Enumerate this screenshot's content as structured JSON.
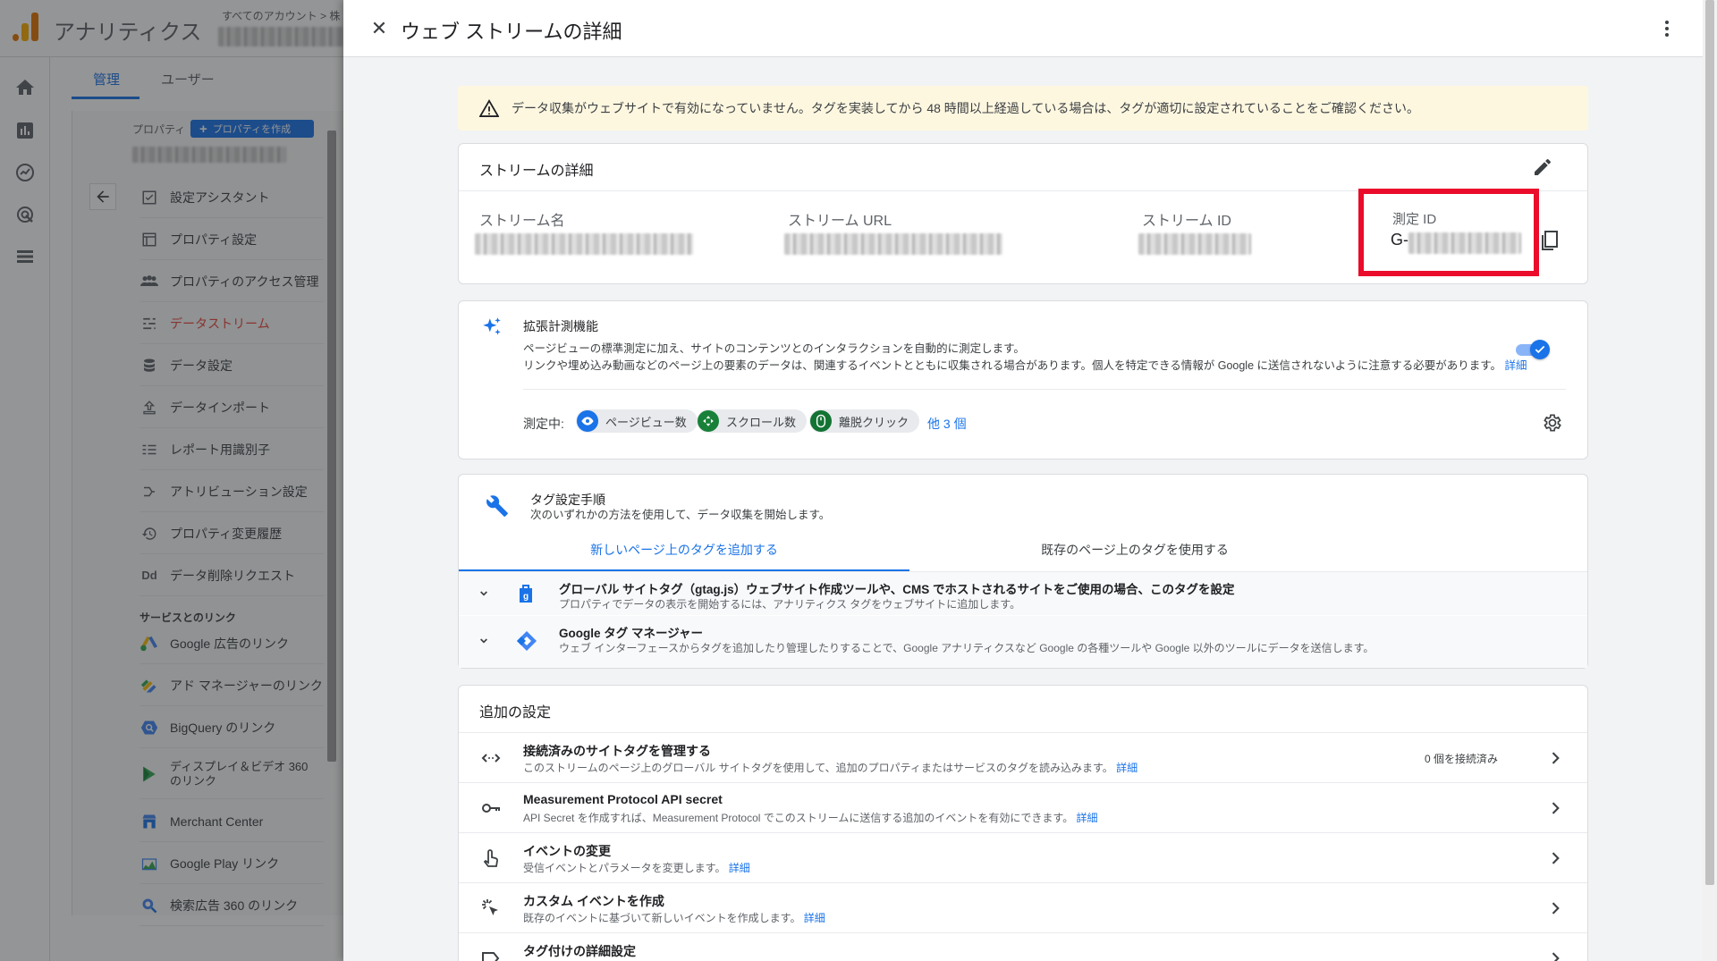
{
  "app": {
    "title": "アナリティクス",
    "account_crumb": "すべてのアカウント > 株",
    "colors": {
      "brand_orange": "#f9ab00",
      "brand_dark_orange": "#e37400",
      "accent": "#1a73e8",
      "active_nav": "#e8453c",
      "highlight_box": "#ea0c2a"
    }
  },
  "admin": {
    "tabs": [
      {
        "label": "管理",
        "active": true
      },
      {
        "label": "ユーザー",
        "active": false
      }
    ],
    "property_label": "プロパティ",
    "create_property_label": "プロパティを作成",
    "nav": [
      {
        "label": "設定アシスタント",
        "icon": "checkbox-icon"
      },
      {
        "label": "プロパティ設定",
        "icon": "property-icon"
      },
      {
        "label": "プロパティのアクセス管理",
        "icon": "people-icon"
      },
      {
        "label": "データストリーム",
        "icon": "streams-icon",
        "active": true
      },
      {
        "label": "データ設定",
        "icon": "database-icon"
      },
      {
        "label": "データインポート",
        "icon": "upload-icon"
      },
      {
        "label": "レポート用識別子",
        "icon": "identity-icon"
      },
      {
        "label": "アトリビューション設定",
        "icon": "attribution-icon"
      },
      {
        "label": "プロパティ変更履歴",
        "icon": "history-icon"
      },
      {
        "label": "データ削除リクエスト",
        "icon": "delete-request-icon",
        "glyph": "Dd"
      }
    ],
    "links_heading": "サービスとのリンク",
    "links": [
      {
        "label": "Google 広告のリンク",
        "icon": "google-ads-icon"
      },
      {
        "label": "アド マネージャーのリンク",
        "icon": "ad-manager-icon"
      },
      {
        "label": "BigQuery のリンク",
        "icon": "bigquery-icon"
      },
      {
        "label": "ディスプレイ＆ビデオ 360 のリンク",
        "icon": "dv360-icon"
      },
      {
        "label": "Merchant Center",
        "icon": "merchant-center-icon"
      },
      {
        "label": "Google Play リンク",
        "icon": "google-play-icon"
      },
      {
        "label": "検索広告 360 のリンク",
        "icon": "search-ads-icon"
      }
    ]
  },
  "drawer": {
    "title": "ウェブ ストリームの詳細",
    "warning": "データ収集がウェブサイトで有効になっていません。タグを実装してから 48 時間以上経過している場合は、タグが適切に設定されていることをご確認ください。",
    "stream_details": {
      "title": "ストリームの詳細",
      "fields": [
        {
          "label": "ストリーム名"
        },
        {
          "label": "ストリーム URL"
        },
        {
          "label": "ストリーム ID"
        },
        {
          "label": "測定 ID",
          "prefix": "G-"
        }
      ]
    },
    "enhanced": {
      "title": "拡張計測機能",
      "desc1": "ページビューの標準測定に加え、サイトのコンテンツとのインタラクションを自動的に測定します。",
      "desc2": "リンクや埋め込み動画などのページ上の要素のデータは、関連するイベントとともに収集される場合があります。個人を特定できる情報が Google に送信されないように注意する必要があります。",
      "learn_more": "詳細",
      "enabled": true,
      "measuring_label": "測定中:",
      "chips": [
        {
          "label": "ページビュー数",
          "icon": "eye-icon",
          "color": "#1a73e8"
        },
        {
          "label": "スクロール数",
          "icon": "scroll-icon",
          "color": "#188038"
        },
        {
          "label": "離脱クリック",
          "icon": "mouse-icon",
          "color": "#137333"
        }
      ],
      "more": "他 3 個"
    },
    "tagging": {
      "title": "タグ設定手順",
      "subtitle": "次のいずれかの方法を使用して、データ収集を開始します。",
      "tabs": [
        {
          "label": "新しいページ上のタグを追加する",
          "active": true
        },
        {
          "label": "既存のページ上のタグを使用する",
          "active": false
        }
      ],
      "rows": [
        {
          "title": "グローバル サイトタグ（gtag.js）ウェブサイト作成ツールや、CMS でホストされるサイトをご使用の場合、このタグを設定",
          "sub": "プロパティでデータの表示を開始するには、アナリティクス タグをウェブサイトに追加します。"
        },
        {
          "title": "Google タグ マネージャー",
          "sub": "ウェブ インターフェースからタグを追加したり管理したりすることで、Google アナリティクスなど Google の各種ツールや Google 以外のツールにデータを送信します。"
        }
      ]
    },
    "additional": {
      "title": "追加の設定",
      "rows": [
        {
          "title": "接続済みのサイトタグを管理する",
          "sub": "このストリームのページ上のグローバル サイトタグを使用して、追加のプロパティまたはサービスのタグを読み込みます。",
          "link": "詳細",
          "meta": "0 個を接続済み",
          "icon": "code-icon"
        },
        {
          "title": "Measurement Protocol API secret",
          "sub": "API Secret を作成すれば、Measurement Protocol でこのストリームに送信する追加のイベントを有効にできます。",
          "link": "詳細",
          "icon": "key-icon"
        },
        {
          "title": "イベントの変更",
          "sub": "受信イベントとパラメータを変更します。",
          "link": "詳細",
          "icon": "touch-icon"
        },
        {
          "title": "カスタム イベントを作成",
          "sub": "既存のイベントに基づいて新しいイベントを作成します。",
          "link": "詳細",
          "icon": "sparkle-click-icon"
        },
        {
          "title": "タグ付けの詳細設定",
          "sub": "",
          "link": "",
          "icon": "label-icon"
        }
      ]
    }
  }
}
